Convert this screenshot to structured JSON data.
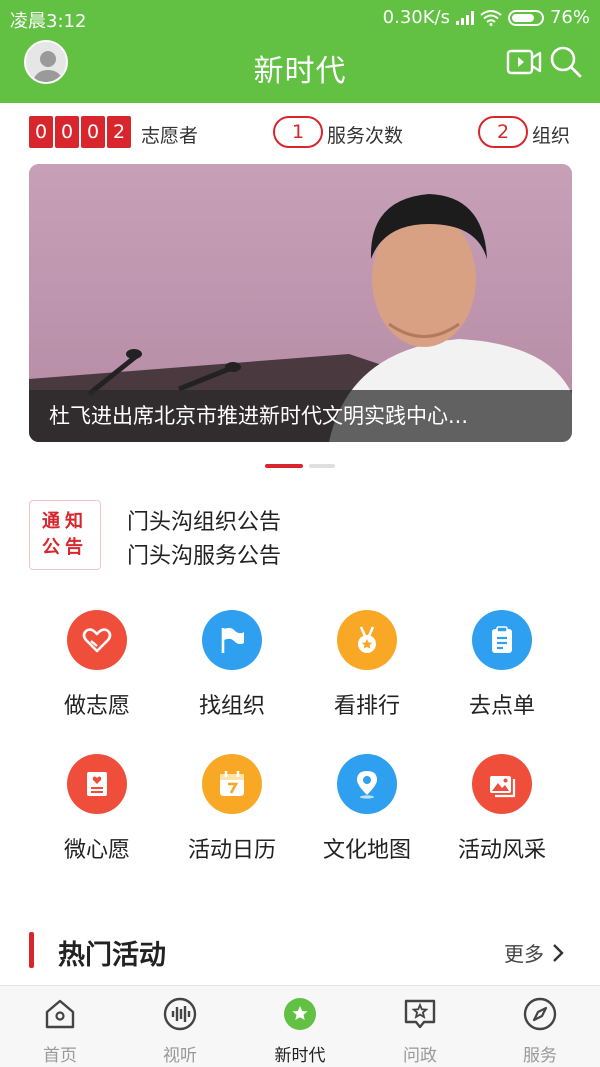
{
  "status_bar": {
    "time": "凌晨3:12",
    "speed": "0.30K/s",
    "battery": "76%"
  },
  "header": {
    "title": "新时代",
    "avatar_icon": "avatar-icon",
    "video_icon": "video-icon",
    "search_icon": "search-icon"
  },
  "counters": {
    "digits": [
      "0",
      "0",
      "0",
      "2"
    ],
    "volunteers_label": "志愿者",
    "service_count": "1",
    "service_label": "服务次数",
    "org_count": "2",
    "org_label": "组织"
  },
  "banner": {
    "caption": "杜飞进出席北京市推进新时代文明实践中心...",
    "active_index": 0,
    "total": 2
  },
  "notices": {
    "badge_line1": "通知",
    "badge_line2": "公告",
    "items": [
      "门头沟组织公告",
      "门头沟服务公告"
    ]
  },
  "grid": [
    {
      "label": "做志愿",
      "icon": "heart-hands-icon",
      "color": "#ef4f3a"
    },
    {
      "label": "找组织",
      "icon": "flag-icon",
      "color": "#2f9ff0"
    },
    {
      "label": "看排行",
      "icon": "medal-icon",
      "color": "#f8a825"
    },
    {
      "label": "去点单",
      "icon": "clipboard-icon",
      "color": "#2f9ff0"
    },
    {
      "label": "微心愿",
      "icon": "wish-card-icon",
      "color": "#ef4f3a"
    },
    {
      "label": "活动日历",
      "icon": "calendar-icon",
      "color": "#f8a825"
    },
    {
      "label": "文化地图",
      "icon": "map-pin-icon",
      "color": "#2f9ff0"
    },
    {
      "label": "活动风采",
      "icon": "photos-icon",
      "color": "#ef4f3a"
    }
  ],
  "hot": {
    "title": "热门活动",
    "more": "更多"
  },
  "bottom_nav": [
    {
      "label": "首页",
      "icon": "home-icon",
      "active": false
    },
    {
      "label": "视听",
      "icon": "audio-wave-icon",
      "active": false
    },
    {
      "label": "新时代",
      "icon": "star-icon",
      "active": true
    },
    {
      "label": "问政",
      "icon": "message-star-icon",
      "active": false
    },
    {
      "label": "服务",
      "icon": "compass-icon",
      "active": false
    }
  ],
  "colors": {
    "brand_green": "#62c043",
    "accent_red": "#d9262c"
  }
}
